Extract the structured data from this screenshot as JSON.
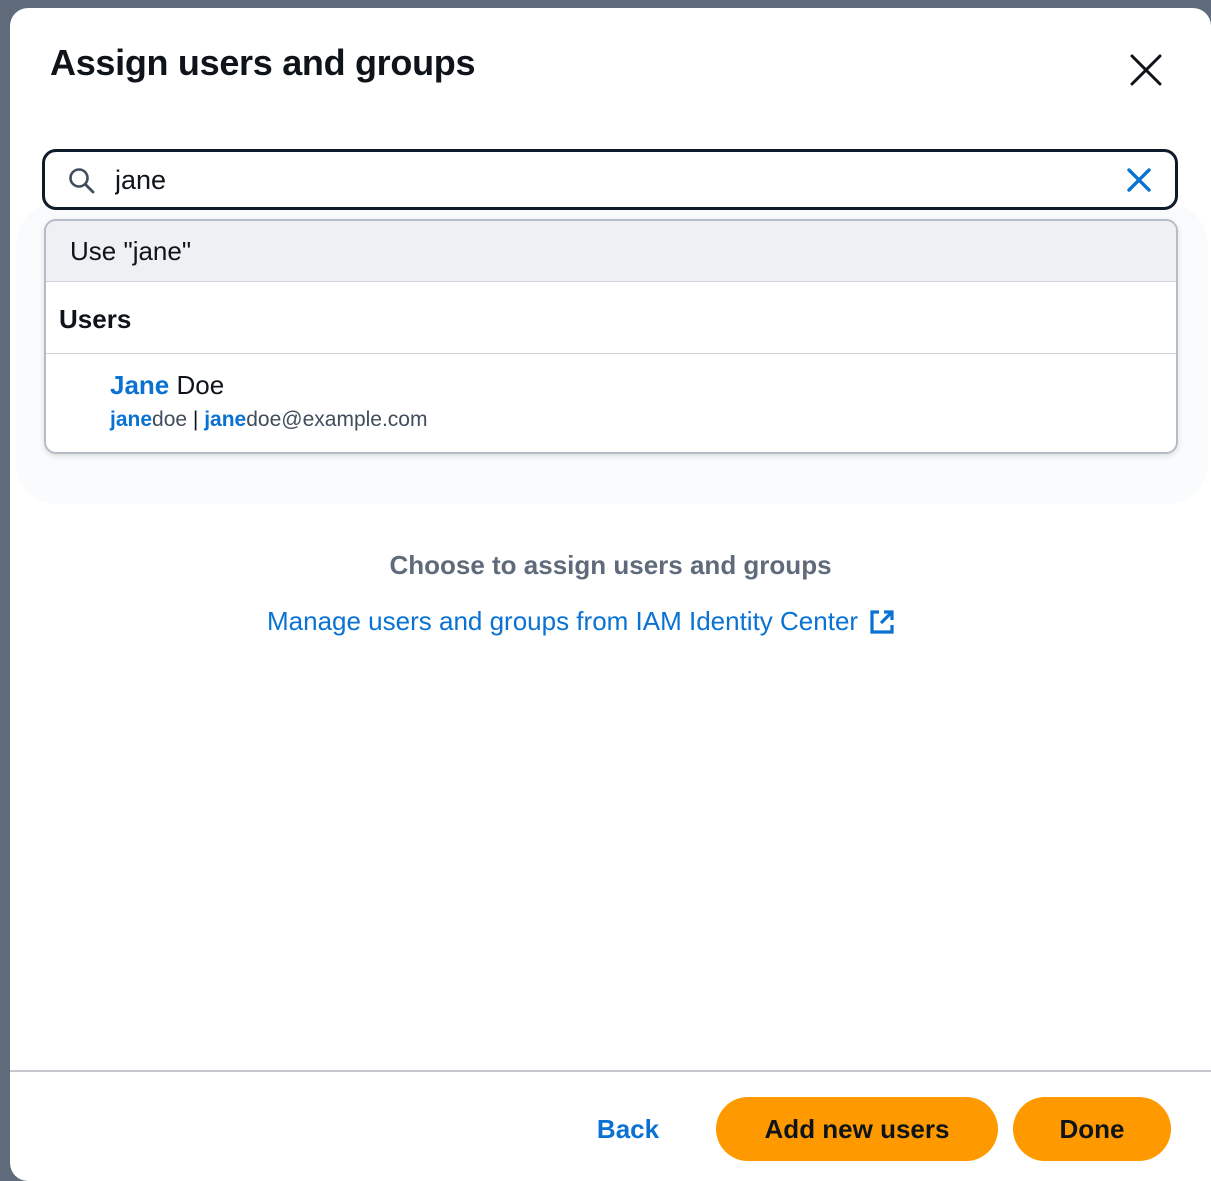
{
  "modal": {
    "title": "Assign users and groups",
    "close_label": "Close"
  },
  "search": {
    "value": "jane",
    "clear_label": "Clear"
  },
  "dropdown": {
    "use_option": "Use \"jane\"",
    "group_label": "Users",
    "users": [
      {
        "name_match": "Jane",
        "name_rest": " Doe",
        "username_match": "jane",
        "username_rest": "doe",
        "separator": " | ",
        "email_match": "jane",
        "email_rest": "doe@example.com"
      }
    ]
  },
  "empty_state": {
    "title": "Choose to assign users and groups",
    "link_label": "Manage users and groups from IAM Identity Center"
  },
  "footer": {
    "back_label": "Back",
    "add_label": "Add new users",
    "done_label": "Done"
  },
  "colors": {
    "accent": "#0972d3",
    "primary_button": "#ff9900",
    "text": "#0f141a",
    "muted_text": "#5f6b7a"
  },
  "icons": {
    "close": "close-icon",
    "search": "search-icon",
    "clear": "clear-icon",
    "external": "external-link-icon"
  }
}
